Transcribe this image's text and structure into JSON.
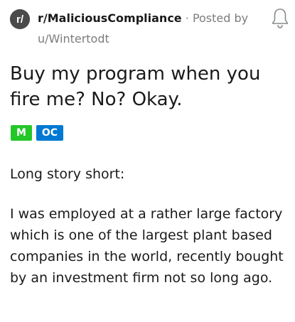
{
  "post": {
    "subreddit": "r/MaliciousCompliance",
    "separator": "·",
    "posted_by": "Posted by",
    "author": "u/Wintertodt",
    "title": "Buy my program when you fire me? No? Okay.",
    "flairs": [
      {
        "label": "M",
        "color": "#24c728"
      },
      {
        "label": "OC",
        "color": "#0079d3"
      }
    ],
    "paragraphs": [
      "Long story short:",
      "I was employed at a rather large factory which is one of the largest plant based companies in the world, recently bought by an investment firm not so long ago."
    ]
  },
  "icons": {
    "subreddit_avatar": "reddit-r-avatar-icon",
    "notification": "bell-icon"
  }
}
